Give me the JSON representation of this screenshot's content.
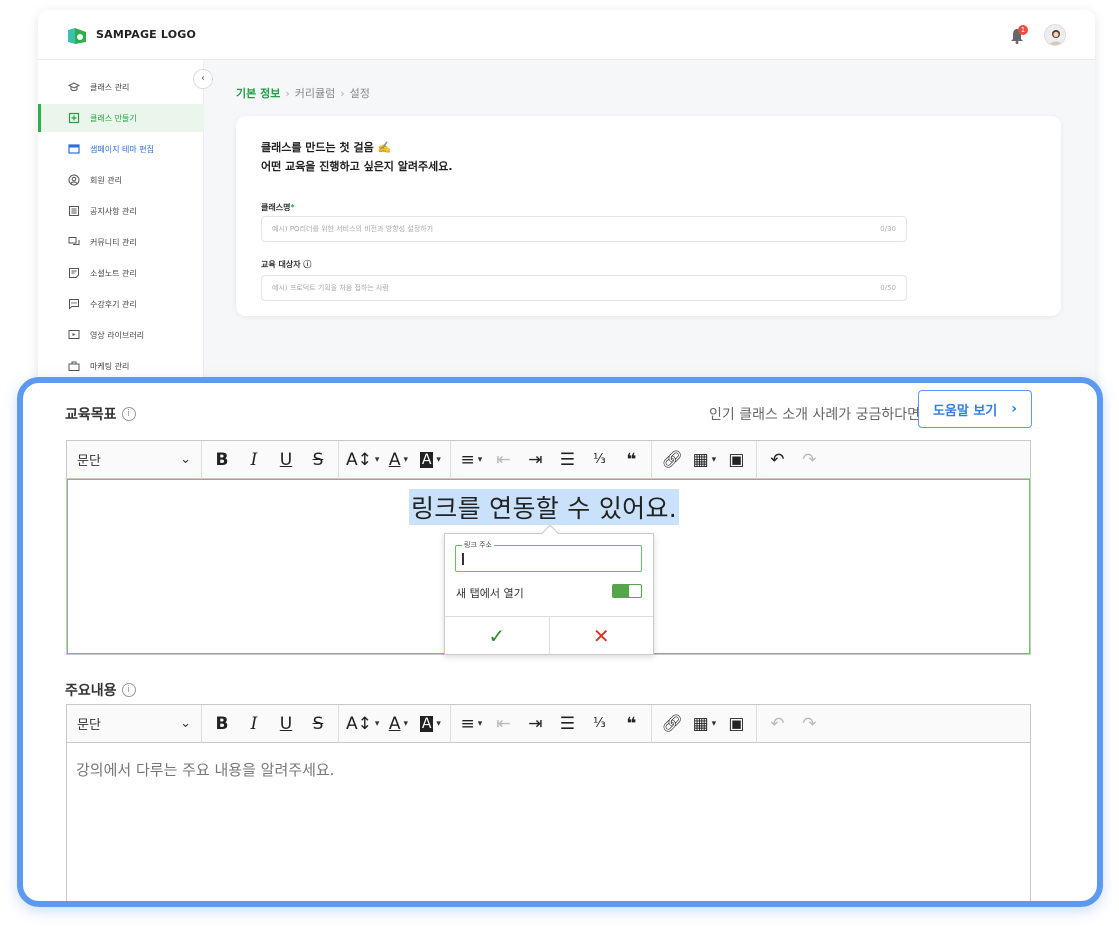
{
  "header": {
    "logo_text": "SAMPAGE LOGO",
    "notification_count": "1"
  },
  "sidebar": {
    "items": [
      {
        "label": "클래스 관리",
        "icon": "graduation-cap-icon"
      },
      {
        "label": "클래스 만들기",
        "icon": "plus-square-icon"
      },
      {
        "label": "샘페이지 테마 편집",
        "icon": "browser-window-icon"
      },
      {
        "label": "회원 관리",
        "icon": "user-circle-icon"
      },
      {
        "label": "공지사항 관리",
        "icon": "notice-board-icon"
      },
      {
        "label": "커뮤니티 관리",
        "icon": "chat-bubbles-icon"
      },
      {
        "label": "소셜노트 관리",
        "icon": "note-icon"
      },
      {
        "label": "수강후기 관리",
        "icon": "comment-dots-icon"
      },
      {
        "label": "영상 라이브러리",
        "icon": "video-library-icon"
      },
      {
        "label": "마케팅 관리",
        "icon": "marketing-icon"
      }
    ]
  },
  "breadcrumb": {
    "step1": "기본 정보",
    "step2": "커리큘럼",
    "step3": "설정"
  },
  "card": {
    "title_line1": "클래스를 만드는 첫 걸음 ✍️",
    "title_line2": "어떤 교육을 진행하고 싶은지 알려주세요.",
    "class_name_label": "클래스명",
    "class_name_required": "*",
    "class_name_placeholder": "예시) PO리더를 위한 서비스의 비전과 방향성 설정하기",
    "class_name_counter": "0/30",
    "target_label": "교육 대상자",
    "target_placeholder": "예시) 프로덕트 기획을 처음 접하는 사람",
    "target_counter": "0/50"
  },
  "goal_section": {
    "label": "교육목표",
    "help_text": "인기 클래스 소개 사례가 궁금하다면",
    "help_button": "도움말 보기",
    "editor": {
      "paragraph_select": "문단",
      "selected_text": "링크를 연동할 수 있어요.",
      "link_popup": {
        "url_label": "링크 주소",
        "newtab_label": "새 탭에서 열기",
        "newtab_on": true
      }
    }
  },
  "content_section": {
    "label": "주요내용",
    "editor": {
      "paragraph_select": "문단",
      "placeholder": "강의에서 다루는 주요 내용을 알려주세요."
    }
  },
  "colors": {
    "accent_green": "#2fae4c",
    "highlight_blue": "#5b9af0",
    "selection_bg": "#c9e1fb"
  }
}
